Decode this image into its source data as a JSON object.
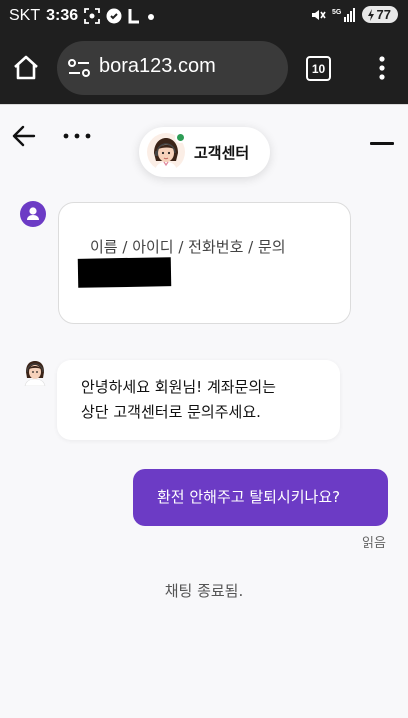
{
  "status_bar": {
    "carrier": "SKT",
    "time": "3:36",
    "network": "5G",
    "battery": "77"
  },
  "browser": {
    "url": "bora123.com",
    "tab_count": "10"
  },
  "chat": {
    "header_title": "고객센터",
    "form_prompt": "이름 / 아이디 / 전화번호 / 문의",
    "agent_message_lines": [
      "안녕하세요 회원님! 계좌문의는",
      "상단 고객센터로 문의주세요."
    ],
    "user_message": "환전 안해주고 탈퇴시키나요?",
    "read_receipt": "읽음",
    "chat_ended": "채팅 종료됨."
  },
  "colors": {
    "accent": "#6c3bc5",
    "online": "#2d9c55",
    "status_bar_bg": "#1f1f1f",
    "chat_bg": "#f8f8fa"
  },
  "icons": [
    "screenshot-icon",
    "pause-icon",
    "l-icon",
    "notification-dot-icon",
    "mute-icon",
    "signal-icon",
    "home-icon",
    "site-settings-icon",
    "tabs-icon",
    "more-vert-icon",
    "back-arrow-icon",
    "more-horiz-icon",
    "minimize-icon",
    "agent-avatar-icon",
    "user-icon"
  ]
}
